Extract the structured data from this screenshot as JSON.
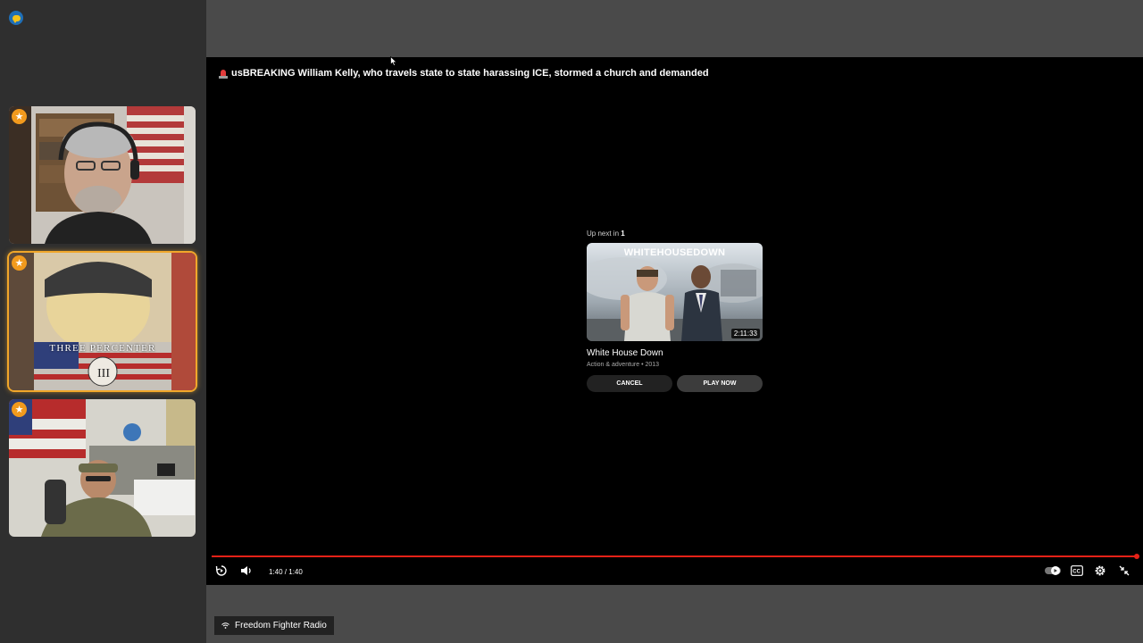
{
  "app": {
    "logo_icon": "chat-bubble-icon"
  },
  "participants": [
    {
      "name": "participant-1",
      "badge": "★",
      "active": false
    },
    {
      "name": "participant-2",
      "badge": "★",
      "active": true,
      "overlay_text": "THREE PERCENTER"
    },
    {
      "name": "participant-3",
      "badge": "★",
      "active": false
    }
  ],
  "player": {
    "title": "usBREAKING William Kelly, who travels state to state harassing ICE, stormed a church and demanded",
    "title_icon": "police-siren-icon",
    "up_next": {
      "label_prefix": "Up next in",
      "countdown": "1",
      "thumbnail_title": "WHITEHOUSEDOWN",
      "duration": "2:11:33",
      "video_name": "White House Down",
      "video_meta": "Action & adventure • 2013",
      "cancel_label": "CANCEL",
      "play_label": "PLAY NOW"
    },
    "progress_fraction": 1.0,
    "time_display": "1:40 / 1:40",
    "accent_color": "#e62117"
  },
  "bottom": {
    "radio_label": "Freedom Fighter Radio",
    "radio_icon": "wifi-icon"
  }
}
